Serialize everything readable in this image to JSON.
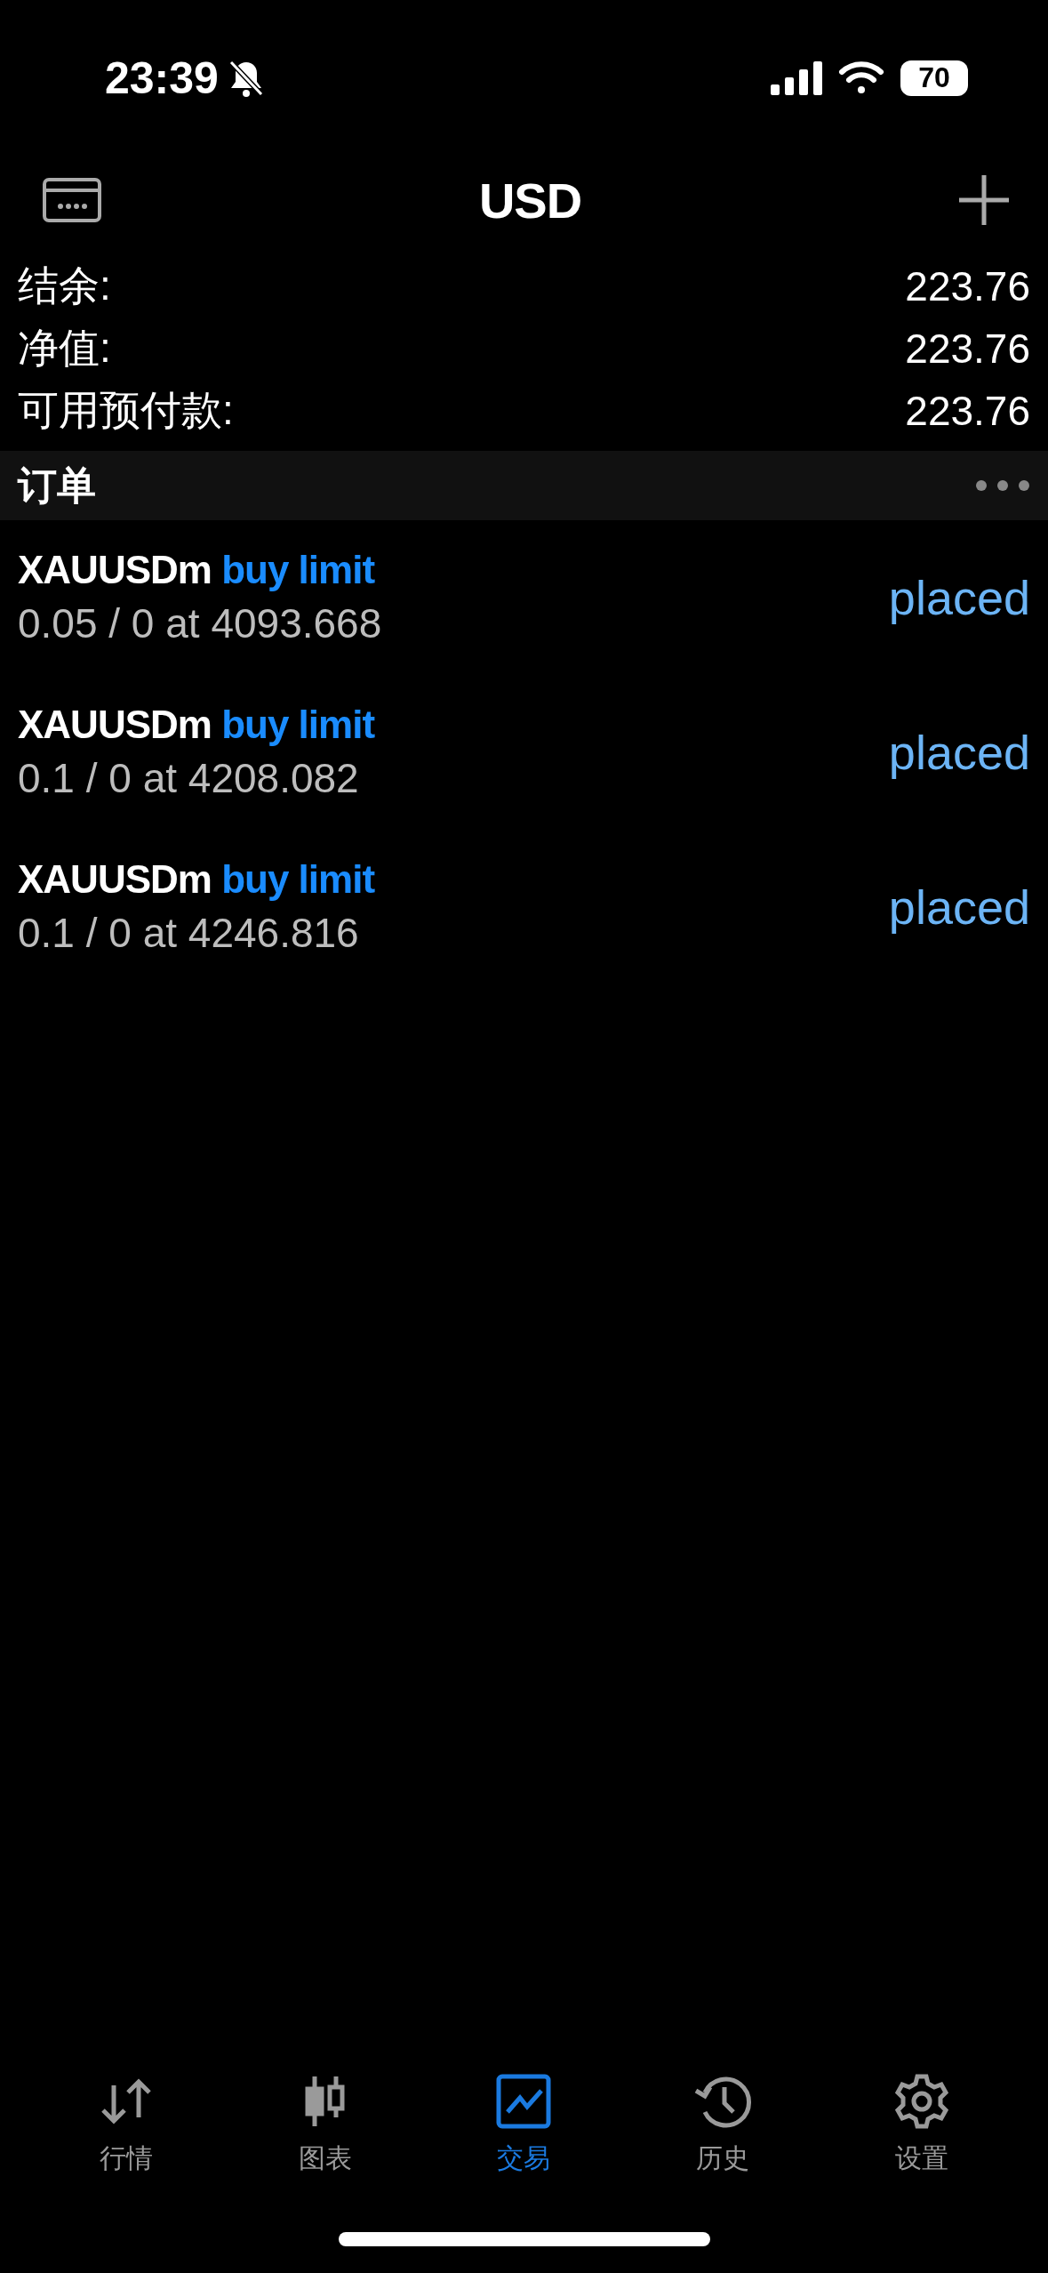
{
  "status_bar": {
    "time": "23:39",
    "silent": true,
    "battery": "70"
  },
  "header": {
    "title": "USD"
  },
  "account": [
    {
      "label": "结余:",
      "value": "223.76"
    },
    {
      "label": "净值:",
      "value": "223.76"
    },
    {
      "label": "可用预付款:",
      "value": "223.76"
    }
  ],
  "section": {
    "title": "订单"
  },
  "orders": [
    {
      "symbol": "XAUUSDm",
      "type": "buy limit",
      "detail": "0.05 / 0 at 4093.668",
      "status": "placed"
    },
    {
      "symbol": "XAUUSDm",
      "type": "buy limit",
      "detail": "0.1 / 0 at 4208.082",
      "status": "placed"
    },
    {
      "symbol": "XAUUSDm",
      "type": "buy limit",
      "detail": "0.1 / 0 at 4246.816",
      "status": "placed"
    }
  ],
  "tabs": [
    {
      "kind": "quotes",
      "label": "行情",
      "selected": false
    },
    {
      "kind": "chart",
      "label": "图表",
      "selected": false
    },
    {
      "kind": "trade",
      "label": "交易",
      "selected": true
    },
    {
      "kind": "history",
      "label": "历史",
      "selected": false
    },
    {
      "kind": "settings",
      "label": "设置",
      "selected": false
    }
  ]
}
